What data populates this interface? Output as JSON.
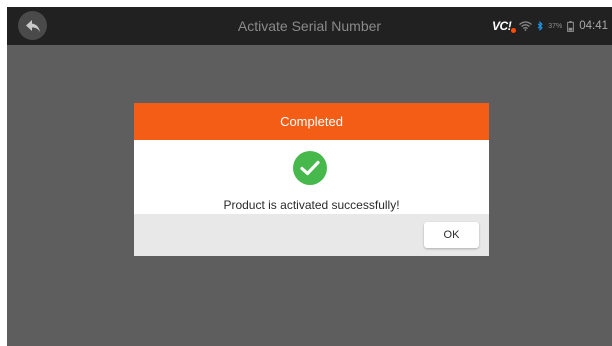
{
  "app": {
    "title": "Activate Serial Number"
  },
  "status_bar": {
    "vci_logo": "VC",
    "vci_mark": "!",
    "battery_percent": "37%",
    "time": "04:41",
    "icons": [
      "wifi-icon",
      "bluetooth-icon",
      "battery-icon"
    ]
  },
  "dialog": {
    "title": "Completed",
    "message": "Product is activated successfully!",
    "ok_label": "OK",
    "icon": "success-check-icon"
  },
  "colors": {
    "topbar": "#212121",
    "backdrop": "#5e5e5e",
    "dialog_header": "#f45d16",
    "success": "#47b84c",
    "footer": "#e8e8e8"
  }
}
